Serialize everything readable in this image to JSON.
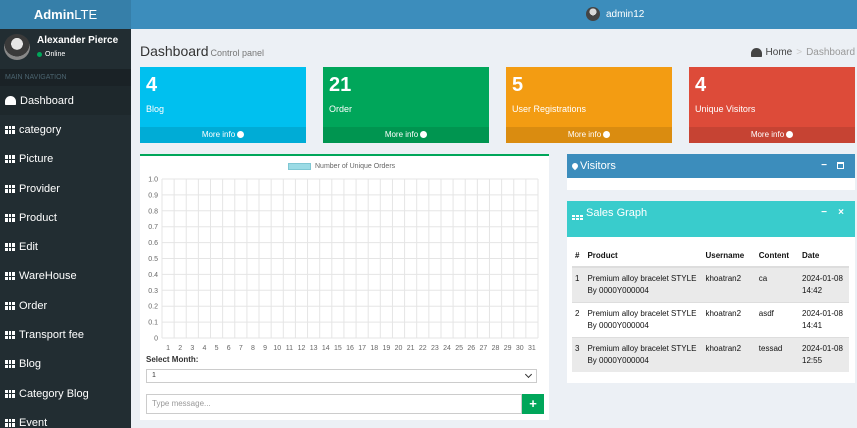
{
  "header": {
    "logo_bold": "Admin",
    "logo_rest": "LTE",
    "user": "admin12"
  },
  "sidebar": {
    "user_name": "Alexander Pierce",
    "user_status": "Online",
    "nav_header": "MAIN NAVIGATION",
    "items": [
      {
        "label": "Dashboard",
        "icon": "dashboard-icon"
      },
      {
        "label": "category",
        "icon": "grid-icon"
      },
      {
        "label": "Picture",
        "icon": "grid-icon"
      },
      {
        "label": "Provider",
        "icon": "grid-icon"
      },
      {
        "label": "Product",
        "icon": "grid-icon"
      },
      {
        "label": "Edit",
        "icon": "grid-icon"
      },
      {
        "label": "WareHouse",
        "icon": "grid-icon"
      },
      {
        "label": "Order",
        "icon": "grid-icon"
      },
      {
        "label": "Transport fee",
        "icon": "grid-icon"
      },
      {
        "label": "Blog",
        "icon": "grid-icon"
      },
      {
        "label": "Category Blog",
        "icon": "grid-icon"
      },
      {
        "label": "Event",
        "icon": "grid-icon"
      }
    ]
  },
  "page": {
    "title": "Dashboard",
    "subtitle": "Control panel",
    "breadcrumb_home": "Home",
    "breadcrumb_sep": ">",
    "breadcrumb_current": "Dashboard"
  },
  "stats": [
    {
      "number": "4",
      "label": "Blog",
      "more": "More info",
      "color": "#00c0ef"
    },
    {
      "number": "21",
      "label": "Order",
      "more": "More info",
      "color": "#00a65a"
    },
    {
      "number": "5",
      "label": "User Registrations",
      "more": "More info",
      "color": "#f39c12"
    },
    {
      "number": "4",
      "label": "Unique Visitors",
      "more": "More info",
      "color": "#dd4b39"
    }
  ],
  "chart_data": {
    "type": "bar",
    "legend": [
      "Number of Unique Orders"
    ],
    "categories": [
      "1",
      "2",
      "3",
      "4",
      "5",
      "6",
      "7",
      "8",
      "9",
      "10",
      "11",
      "12",
      "13",
      "14",
      "15",
      "16",
      "17",
      "18",
      "19",
      "20",
      "21",
      "22",
      "23",
      "24",
      "25",
      "26",
      "27",
      "28",
      "29",
      "30",
      "31"
    ],
    "series": [
      {
        "name": "Number of Unique Orders",
        "values": []
      }
    ],
    "y_ticks": [
      "0",
      "0.1",
      "0.2",
      "0.3",
      "0.4",
      "0.5",
      "0.6",
      "0.7",
      "0.8",
      "0.9",
      "1.0"
    ],
    "ylim": [
      0,
      1
    ],
    "grid": true,
    "legend_position": "top",
    "bar_color": "#9bdbe5"
  },
  "chart_controls": {
    "select_label": "Select Month:",
    "select_value": "1",
    "message_placeholder": "Type message...",
    "send_label": "+"
  },
  "visitors": {
    "title": "Visitors",
    "minimize": "−"
  },
  "sales": {
    "title": "Sales Graph",
    "minimize": "−",
    "close": "×",
    "columns": [
      "#",
      "Product",
      "Username",
      "Content",
      "Date"
    ],
    "rows": [
      [
        "1",
        "Premium alloy bracelet STYLE By 0000Y000004",
        "khoatran2",
        "ca",
        "2024-01-08 14:42"
      ],
      [
        "2",
        "Premium alloy bracelet STYLE By 0000Y000004",
        "khoatran2",
        "asdf",
        "2024-01-08 14:41"
      ],
      [
        "3",
        "Premium alloy bracelet STYLE By 0000Y000004",
        "khoatran2",
        "tessad",
        "2024-01-08 12:55"
      ]
    ]
  }
}
